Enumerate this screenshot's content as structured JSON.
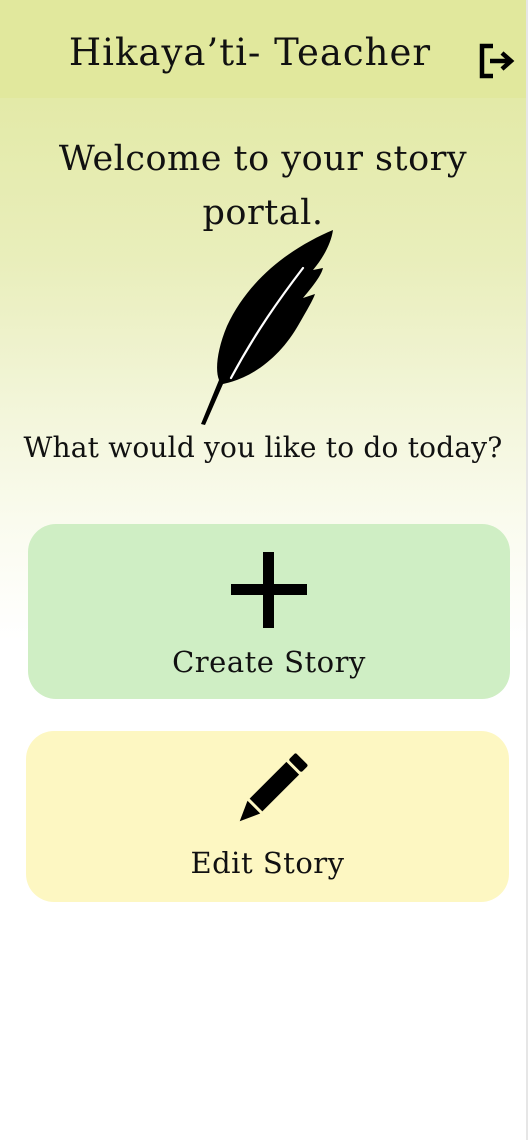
{
  "header": {
    "title": "Hikaya’ti- Teacher",
    "logout_icon": "logout-icon"
  },
  "main": {
    "welcome": "Welcome to your story portal.",
    "illustration_icon": "quill-feather-icon",
    "prompt": "What would you like to do today?"
  },
  "actions": [
    {
      "label": "Create Story",
      "icon": "plus-icon",
      "color": "#cfeec4"
    },
    {
      "label": "Edit Story",
      "icon": "pencil-icon",
      "color": "#fdf7c2"
    }
  ],
  "colors": {
    "header_bg": "#e1e89d",
    "text": "#111111"
  }
}
